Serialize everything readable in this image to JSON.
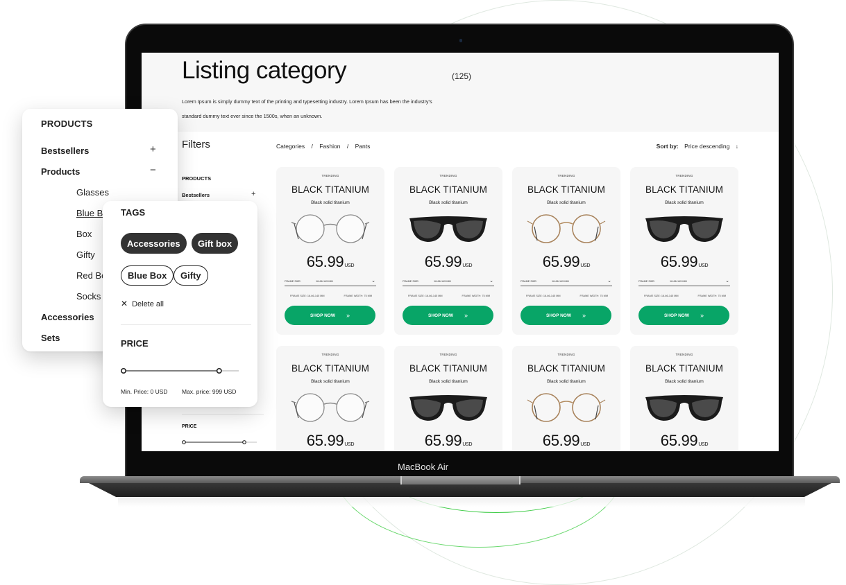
{
  "device": {
    "label": "MacBook Air"
  },
  "page": {
    "title": "Listing category",
    "count": "(125)",
    "description": "Lorem Ipsum is simply dummy text of the printing and typesetting industry. Lorem Ipsum has been the industry's standard dummy text ever since the 1500s, when an unknown."
  },
  "filters": {
    "title": "Filters",
    "products_heading": "PRODUCTS",
    "bestsellers": "Bestsellers",
    "price_heading": "PRICE"
  },
  "breadcrumb": [
    "Categories",
    "/",
    "Fashion",
    "/",
    "Pants"
  ],
  "sort": {
    "label": "Sort by:",
    "value": "Price descending",
    "icon": "arrow-down"
  },
  "products": [
    {
      "tag": "TRENDING",
      "name": "BLACK TITANIUM",
      "subtitle": "Black solid titanium",
      "style": "round-silver",
      "price": "65.99",
      "currency": "USD",
      "frame_size_label": "FRAME SIZE:",
      "frame_size_value": "16-66-145 MM",
      "spec_size": "FRAME SIZE: 16-66-145 MM",
      "spec_width": "FRAME WIDTH: 75 MM",
      "cta": "SHOP NOW"
    },
    {
      "tag": "TRENDING",
      "name": "BLACK TITANIUM",
      "subtitle": "Black solid titanium",
      "style": "black-sun",
      "price": "65.99",
      "currency": "USD",
      "frame_size_label": "FRAME SIZE:",
      "frame_size_value": "16-66-145 MM",
      "spec_size": "FRAME SIZE: 16-66-145 MM",
      "spec_width": "FRAME WIDTH: 75 MM",
      "cta": "SHOP NOW"
    },
    {
      "tag": "TRENDING",
      "name": "BLACK TITANIUM",
      "subtitle": "Black solid titanium",
      "style": "round-gold",
      "price": "65.99",
      "currency": "USD",
      "frame_size_label": "FRAME SIZE:",
      "frame_size_value": "16-66-145 MM",
      "spec_size": "FRAME SIZE: 16-66-145 MM",
      "spec_width": "FRAME WIDTH: 75 MM",
      "cta": "SHOP NOW"
    },
    {
      "tag": "TRENDING",
      "name": "BLACK TITANIUM",
      "subtitle": "Black solid titanium",
      "style": "black-sun",
      "price": "65.99",
      "currency": "USD",
      "frame_size_label": "FRAME SIZE:",
      "frame_size_value": "16-66-145 MM",
      "spec_size": "FRAME SIZE: 16-66-145 MM",
      "spec_width": "FRAME WIDTH: 75 MM",
      "cta": "SHOP NOW"
    },
    {
      "tag": "TRENDING",
      "name": "BLACK TITANIUM",
      "subtitle": "Black solid titanium",
      "style": "round-silver",
      "price": "65.99",
      "currency": "USD"
    },
    {
      "tag": "TRENDING",
      "name": "BLACK TITANIUM",
      "subtitle": "Black solid titanium",
      "style": "black-sun",
      "price": "65.99",
      "currency": "USD"
    },
    {
      "tag": "TRENDING",
      "name": "BLACK TITANIUM",
      "subtitle": "Black solid titanium",
      "style": "round-gold",
      "price": "65.99",
      "currency": "USD"
    },
    {
      "tag": "TRENDING",
      "name": "BLACK TITANIUM",
      "subtitle": "Black solid titanium",
      "style": "black-sun",
      "price": "65.99",
      "currency": "USD"
    }
  ],
  "products_panel": {
    "title": "PRODUCTS",
    "items": [
      {
        "label": "Bestsellers",
        "level": "top",
        "toggle": "+"
      },
      {
        "label": "Products",
        "level": "top",
        "toggle": "−"
      },
      {
        "label": "Glasses",
        "level": "sub"
      },
      {
        "label": "Blue Box",
        "level": "sub",
        "active": true
      },
      {
        "label": "Box",
        "level": "sub"
      },
      {
        "label": "Gifty",
        "level": "sub"
      },
      {
        "label": "Red Box",
        "level": "sub"
      },
      {
        "label": "Socks",
        "level": "sub"
      },
      {
        "label": "Accessories",
        "level": "top"
      },
      {
        "label": "Sets",
        "level": "top"
      }
    ]
  },
  "tags_panel": {
    "title": "TAGS",
    "selected_tags": [
      "Accessories",
      "Gift box"
    ],
    "available_tags": [
      "Blue Box",
      "Gifty"
    ],
    "delete_all": "Delete all",
    "price_title": "PRICE",
    "min_price": "Min. Price: 0 USD",
    "max_price": "Max. price: 999 USD",
    "range_min_fraction": 0,
    "range_max_fraction": 0.83
  },
  "colors": {
    "accent": "#08a567",
    "chip_filled": "#333333",
    "card_bg": "#f6f6f6"
  }
}
